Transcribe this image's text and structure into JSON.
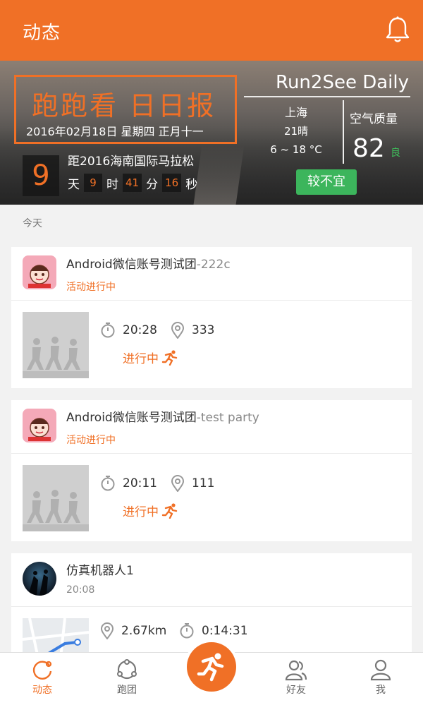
{
  "header": {
    "title": "动态"
  },
  "banner": {
    "title": "跑跑看  日日报",
    "date": "2016年02月18日 星期四 正月十一",
    "brand": "Run2See Daily",
    "weather": {
      "city": "上海",
      "condition": "21晴",
      "temp_range": "6 ~ 18 °C"
    },
    "air": {
      "label": "空气质量",
      "value": "82",
      "level": "良"
    },
    "countdown": {
      "days": "9",
      "event": "距2016海南国际马拉松",
      "day_unit": "天",
      "hours": "9",
      "hour_unit": "时",
      "minutes": "41",
      "minute_unit": "分",
      "seconds": "16",
      "second_unit": "秒"
    },
    "advice": "较不宜"
  },
  "feed": {
    "section_label": "今天",
    "items": [
      {
        "group": "Android微信账号测试团",
        "suffix": "-222c",
        "status": "活动进行中",
        "time": "20:28",
        "location": "333",
        "running_label": "进行中"
      },
      {
        "group": "Android微信账号测试团",
        "suffix": "-test party",
        "status": "活动进行中",
        "time": "20:11",
        "location": "111",
        "running_label": "进行中"
      },
      {
        "user": "仿真机器人1",
        "post_time": "20:08",
        "distance": "2.67km",
        "duration": "0:14:31"
      }
    ]
  },
  "nav": {
    "items": [
      {
        "label": "动态",
        "icon": "feed-icon",
        "active": true
      },
      {
        "label": "跑团",
        "icon": "team-icon",
        "active": false
      },
      {
        "label": "",
        "icon": "run-icon",
        "active": false
      },
      {
        "label": "好友",
        "icon": "friends-icon",
        "active": false
      },
      {
        "label": "我",
        "icon": "profile-icon",
        "active": false
      }
    ]
  },
  "colors": {
    "accent": "#f07026",
    "green": "#3cb55c"
  }
}
